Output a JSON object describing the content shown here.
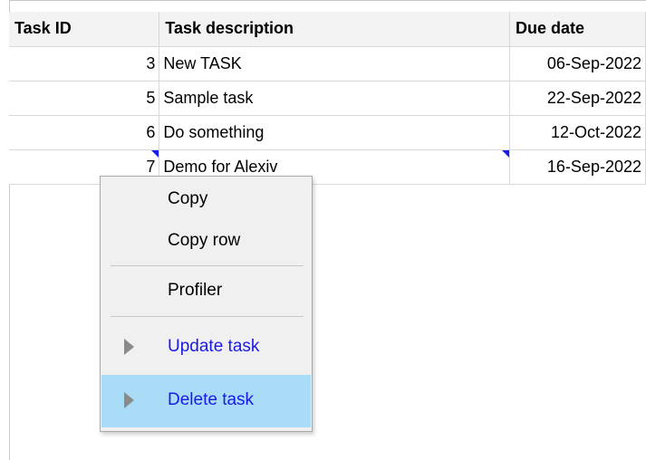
{
  "grid": {
    "columns": [
      "Task ID",
      "Task description",
      "Due date"
    ],
    "rows": [
      {
        "id": "3",
        "description": "New TASK",
        "due": "06-Sep-2022"
      },
      {
        "id": "5",
        "description": "Sample task",
        "due": "22-Sep-2022"
      },
      {
        "id": "6",
        "description": "Do something",
        "due": "12-Oct-2022"
      },
      {
        "id": "7",
        "description": "Demo for Alexiv",
        "due": "16-Sep-2022"
      }
    ],
    "selected_row": "7"
  },
  "context_menu": {
    "items": [
      {
        "label": "Copy",
        "type": "plain"
      },
      {
        "label": "Copy row",
        "type": "plain"
      },
      {
        "label": "Profiler",
        "type": "plain"
      },
      {
        "label": "Update task",
        "type": "action",
        "icon": "play-arrow-icon"
      },
      {
        "label": "Delete task",
        "type": "action",
        "icon": "play-arrow-icon",
        "highlighted": true
      }
    ]
  },
  "colors": {
    "selection": "#a9dcf7",
    "action_text": "#1a1ae6",
    "marker": "#1a1aee"
  }
}
